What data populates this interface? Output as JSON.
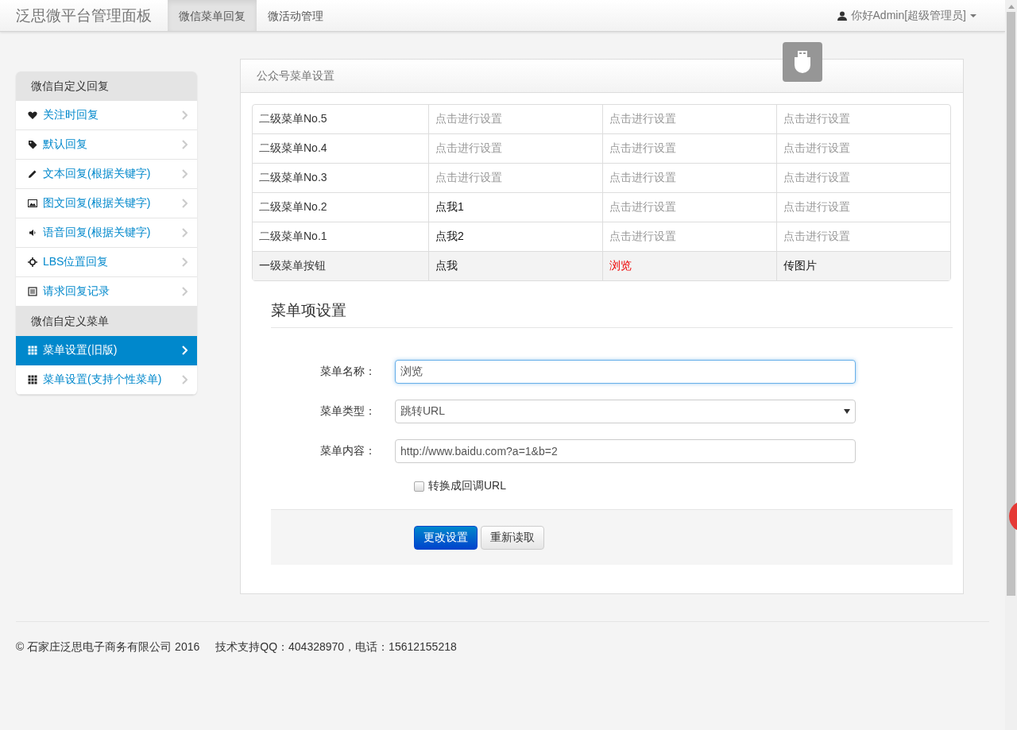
{
  "navbar": {
    "brand": "泛思微平台管理面板",
    "tabs": [
      {
        "label": "微信菜单回复",
        "selected": true
      },
      {
        "label": "微活动管理",
        "selected": false
      }
    ],
    "user": "你好Admin[超级管理员]"
  },
  "sidebar": {
    "sections": [
      {
        "header": "微信自定义回复",
        "items": [
          {
            "kind": "heart",
            "label": "关注时回复",
            "selected": false
          },
          {
            "kind": "tag",
            "label": "默认回复",
            "selected": false
          },
          {
            "kind": "pencil",
            "label": "文本回复(根据关键字)",
            "selected": false
          },
          {
            "kind": "picture",
            "label": "图文回复(根据关键字)",
            "selected": false
          },
          {
            "kind": "volume",
            "label": "语音回复(根据关键字)",
            "selected": false
          },
          {
            "kind": "crosshair",
            "label": "LBS位置回复",
            "selected": false
          },
          {
            "kind": "list",
            "label": "请求回复记录",
            "selected": false
          }
        ]
      },
      {
        "header": "微信自定义菜单",
        "items": [
          {
            "kind": "grid",
            "label": "菜单设置(旧版)",
            "selected": true
          },
          {
            "kind": "grid",
            "label": "菜单设置(支持个性菜单)",
            "selected": false
          }
        ]
      }
    ]
  },
  "panel": {
    "title": "公众号菜单设置",
    "menu_table": {
      "rows": [
        {
          "label": "二级菜单No.5",
          "cells": [
            {
              "text": "点击进行设置",
              "configured": false,
              "selected": false
            },
            {
              "text": "点击进行设置",
              "configured": false,
              "selected": false
            },
            {
              "text": "点击进行设置",
              "configured": false,
              "selected": false
            }
          ]
        },
        {
          "label": "二级菜单No.4",
          "cells": [
            {
              "text": "点击进行设置",
              "configured": false,
              "selected": false
            },
            {
              "text": "点击进行设置",
              "configured": false,
              "selected": false
            },
            {
              "text": "点击进行设置",
              "configured": false,
              "selected": false
            }
          ]
        },
        {
          "label": "二级菜单No.3",
          "cells": [
            {
              "text": "点击进行设置",
              "configured": false,
              "selected": false
            },
            {
              "text": "点击进行设置",
              "configured": false,
              "selected": false
            },
            {
              "text": "点击进行设置",
              "configured": false,
              "selected": false
            }
          ]
        },
        {
          "label": "二级菜单No.2",
          "cells": [
            {
              "text": "点我1",
              "configured": true,
              "selected": false
            },
            {
              "text": "点击进行设置",
              "configured": false,
              "selected": false
            },
            {
              "text": "点击进行设置",
              "configured": false,
              "selected": false
            }
          ]
        },
        {
          "label": "二级菜单No.1",
          "cells": [
            {
              "text": "点我2",
              "configured": true,
              "selected": false
            },
            {
              "text": "点击进行设置",
              "configured": false,
              "selected": false
            },
            {
              "text": "点击进行设置",
              "configured": false,
              "selected": false
            }
          ]
        },
        {
          "label": "一级菜单按钮",
          "cells": [
            {
              "text": "点我",
              "configured": true,
              "selected": false
            },
            {
              "text": "浏览",
              "configured": true,
              "selected": true
            },
            {
              "text": "传图片",
              "configured": true,
              "selected": false
            }
          ]
        }
      ]
    },
    "form": {
      "title": "菜单项设置",
      "name": {
        "label": "菜单名称：",
        "value": "浏览"
      },
      "type": {
        "label": "菜单类型：",
        "value": "跳转URL"
      },
      "content": {
        "label": "菜单内容：",
        "value": "http://www.baidu.com?a=1&b=2"
      },
      "callback": {
        "label": "转换成回调URL",
        "checked": false
      },
      "buttons": [
        {
          "label": "更改设置",
          "kind": "primary"
        },
        {
          "label": "重新读取",
          "kind": "default"
        }
      ]
    }
  },
  "footer": {
    "copyright": "© 石家庄泛思电子商务有限公司 2016",
    "support": "技术支持QQ：404328970，电话：15612155218"
  }
}
